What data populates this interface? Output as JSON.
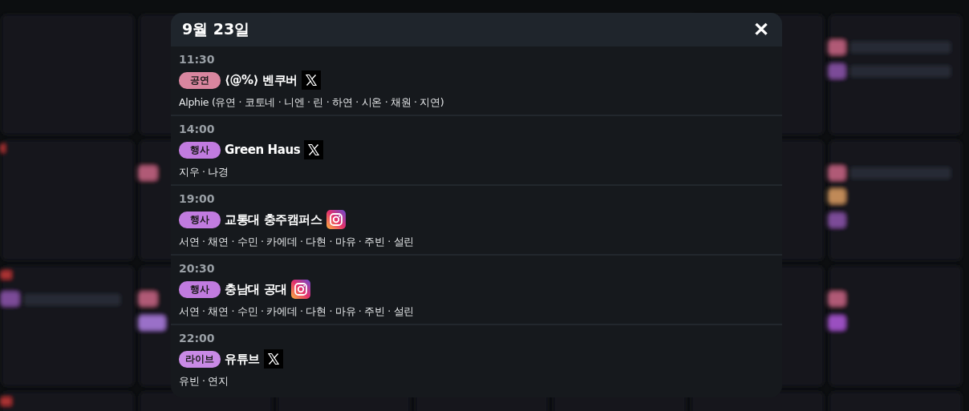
{
  "dialog": {
    "title": "9월 23일",
    "close": "✕"
  },
  "events": [
    {
      "time": "11:30",
      "tag": "공연",
      "color": "#d9869f",
      "title": "⟨@%⟩ 벤쿠버",
      "kind": "x",
      "members": "Alphie (유연 · 코토네 · 니엔 · 린 · 하연 · 시온 · 채원 · 지연)"
    },
    {
      "time": "14:00",
      "tag": "행사",
      "color": "#c17bdf",
      "title": "Green Haus",
      "kind": "x",
      "members": "지우 · 나경"
    },
    {
      "time": "19:00",
      "tag": "행사",
      "color": "#c17bdf",
      "title": "교통대 충주캠퍼스",
      "kind": "instagram",
      "members": "서연 · 채연 · 수민 · 카에데 · 다현 · 마유 · 주빈 · 설린"
    },
    {
      "time": "20:30",
      "tag": "행사",
      "color": "#c17bdf",
      "title": "충남대 공대",
      "kind": "instagram",
      "members": "서연 · 채연 · 수민 · 카에데 · 다현 · 마유 · 주빈 · 설린"
    },
    {
      "time": "22:00",
      "tag": "라이브",
      "color": "#c98ae6",
      "title": "유튜브",
      "kind": "x",
      "members": "유빈 · 연지"
    }
  ]
}
